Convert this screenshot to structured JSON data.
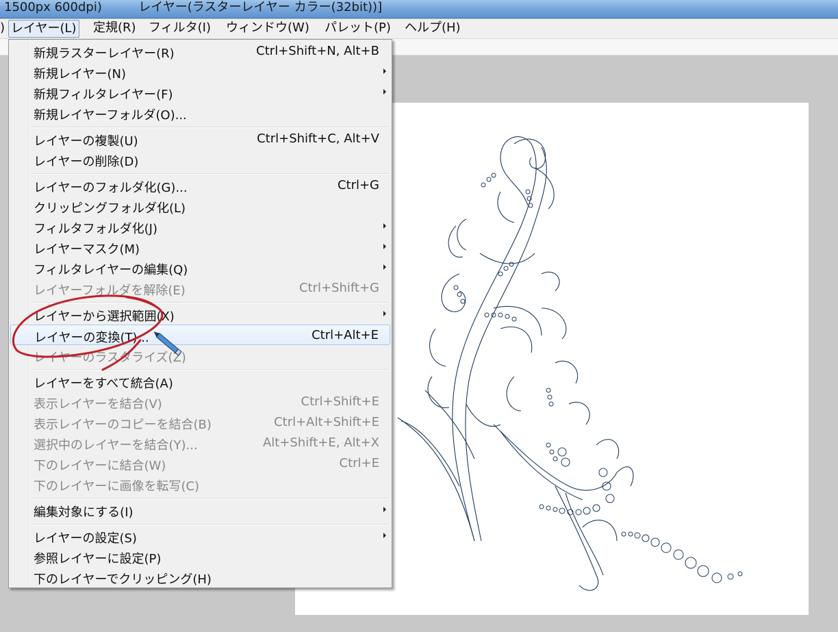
{
  "window": {
    "title_left": "1500px 600dpi)",
    "title_right": "レイヤー(ラスターレイヤー カラー(32bit))]"
  },
  "menubar": {
    "edge": ")",
    "items": [
      "レイヤー(L)",
      "定規(R)",
      "フィルタ(I)",
      "ウィンドウ(W)",
      "パレット(P)",
      "ヘルプ(H)"
    ]
  },
  "menu": {
    "items": [
      {
        "label": "新規ラスターレイヤー(R)",
        "shortcut": "Ctrl+Shift+N, Alt+B"
      },
      {
        "label": "新規レイヤー(N)",
        "submenu": true
      },
      {
        "label": "新規フィルタレイヤー(F)",
        "submenu": true
      },
      {
        "label": "新規レイヤーフォルダ(O)..."
      },
      {
        "label": "レイヤーの複製(U)",
        "shortcut": "Ctrl+Shift+C, Alt+V"
      },
      {
        "label": "レイヤーの削除(D)"
      },
      {
        "label": "レイヤーのフォルダ化(G)...",
        "shortcut": "Ctrl+G"
      },
      {
        "label": "クリッピングフォルダ化(L)"
      },
      {
        "label": "フィルタフォルダ化(J)",
        "submenu": true
      },
      {
        "label": "レイヤーマスク(M)",
        "submenu": true
      },
      {
        "label": "フィルタレイヤーの編集(Q)",
        "submenu": true
      },
      {
        "label": "レイヤーフォルダを解除(E)",
        "shortcut": "Ctrl+Shift+G",
        "disabled": true
      },
      {
        "label": "レイヤーから選択範囲(X)",
        "submenu": true
      },
      {
        "label": "レイヤーの変換(T)...",
        "shortcut": "Ctrl+Alt+E",
        "highlighted": true
      },
      {
        "label": "レイヤーのラスタライズ(Z)",
        "disabled": true
      },
      {
        "label": "レイヤーをすべて統合(A)"
      },
      {
        "label": "表示レイヤーを結合(V)",
        "shortcut": "Ctrl+Shift+E",
        "disabled": true
      },
      {
        "label": "表示レイヤーのコピーを結合(B)",
        "shortcut": "Ctrl+Alt+Shift+E",
        "disabled": true
      },
      {
        "label": "選択中のレイヤーを結合(Y)...",
        "shortcut": "Alt+Shift+E, Alt+X",
        "disabled": true
      },
      {
        "label": "下のレイヤーに結合(W)",
        "shortcut": "Ctrl+E",
        "disabled": true
      },
      {
        "label": "下のレイヤーに画像を転写(C)",
        "disabled": true
      },
      {
        "label": "編集対象にする(I)",
        "submenu": true
      },
      {
        "label": "レイヤーの設定(S)",
        "submenu": true
      },
      {
        "label": "参照レイヤーに設定(P)"
      },
      {
        "label": "下のレイヤーでクリッピング(H)"
      }
    ]
  },
  "colors": {
    "annotation": "#c0202a",
    "ornament_stroke": "#1f3a5c"
  },
  "icons": {
    "cursor": "pen-cursor-icon"
  }
}
